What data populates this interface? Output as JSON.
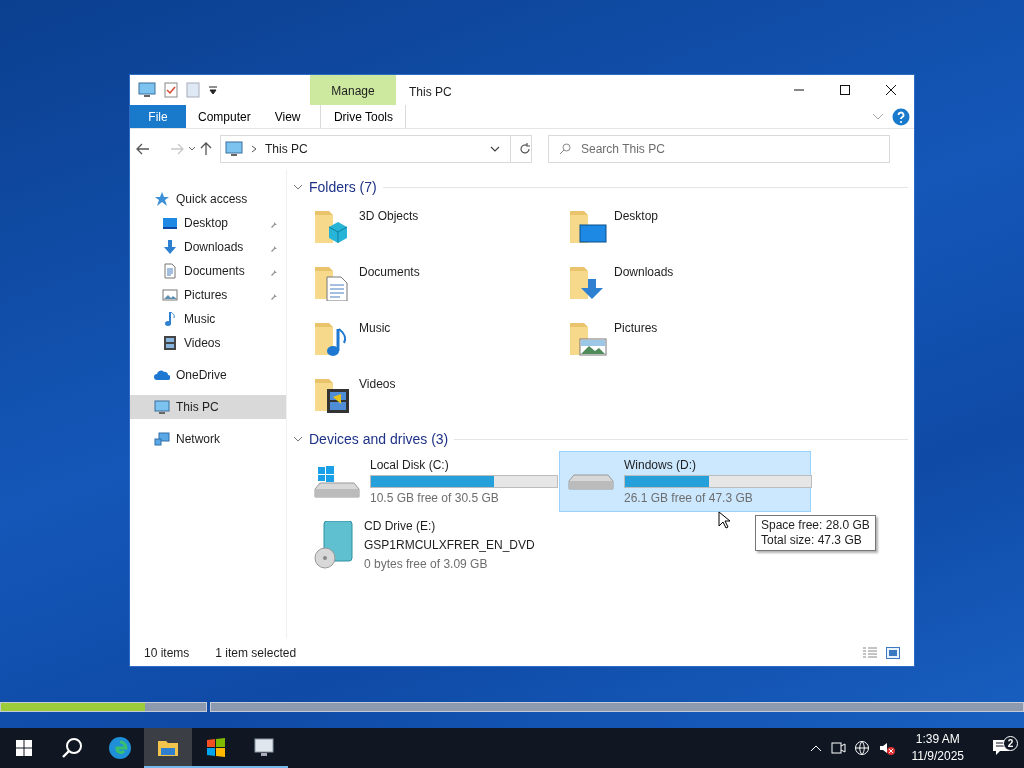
{
  "window": {
    "title": "This PC"
  },
  "ribbon": {
    "context_header": "Manage",
    "tabs": [
      {
        "label": "File",
        "kind": "file",
        "selected": false
      },
      {
        "label": "Computer",
        "kind": "tab",
        "selected": false
      },
      {
        "label": "View",
        "kind": "tab",
        "selected": false
      },
      {
        "label": "Drive Tools",
        "kind": "context",
        "selected": false
      }
    ]
  },
  "address_bar": {
    "path": "This PC"
  },
  "search": {
    "placeholder": "Search This PC"
  },
  "sidebar": {
    "items": [
      {
        "label": "Quick access",
        "kind": "star",
        "selected": false,
        "children": [
          {
            "label": "Desktop",
            "kind": "desktop",
            "pinned": true,
            "selected": false
          },
          {
            "label": "Downloads",
            "kind": "download",
            "pinned": true,
            "selected": false
          },
          {
            "label": "Documents",
            "kind": "document",
            "pinned": true,
            "selected": false
          },
          {
            "label": "Pictures",
            "kind": "picture",
            "pinned": true,
            "selected": false
          },
          {
            "label": "Music",
            "kind": "music",
            "pinned": false,
            "selected": false
          },
          {
            "label": "Videos",
            "kind": "video",
            "pinned": false,
            "selected": false
          }
        ]
      },
      {
        "label": "OneDrive",
        "kind": "cloud",
        "selected": false
      },
      {
        "label": "This PC",
        "kind": "pc",
        "selected": true
      },
      {
        "label": "Network",
        "kind": "network",
        "selected": false
      }
    ]
  },
  "folders": {
    "title": "Folders (7)",
    "expanded": true,
    "items": [
      {
        "name": "3D Objects",
        "kind": "cube"
      },
      {
        "name": "Desktop",
        "kind": "desktop"
      },
      {
        "name": "Documents",
        "kind": "document"
      },
      {
        "name": "Downloads",
        "kind": "download"
      },
      {
        "name": "Music",
        "kind": "music"
      },
      {
        "name": "Pictures",
        "kind": "picture"
      },
      {
        "name": "Videos",
        "kind": "video"
      }
    ]
  },
  "drives": {
    "title": "Devices and drives (3)",
    "expanded": true,
    "items": [
      {
        "name": "Local Disk (C:)",
        "kind": "system",
        "level": 0.66,
        "free": "10.5 GB free of 30.5 GB",
        "selected": false
      },
      {
        "name": "Windows (D:)",
        "kind": "disk",
        "level": 0.45,
        "free": "26.1 GB free of 47.3 GB",
        "selected": true
      },
      {
        "name": "CD Drive (E:)",
        "kind": "cd",
        "label": "GSP1RMCULXFRER_EN_DVD",
        "free": "0 bytes free of 3.09 GB",
        "selected": false
      }
    ]
  },
  "tooltip": {
    "lines": [
      "Space free: 28.0 GB",
      "Total size: 47.3 GB"
    ]
  },
  "status_bar": {
    "count": "10 items",
    "selection": "1 item selected"
  },
  "setup_progress": {
    "level": 0.7
  },
  "taskbar": {
    "apps": [
      {
        "kind": "edge",
        "active": false,
        "running": false
      },
      {
        "kind": "explorer",
        "active": true,
        "running": true
      },
      {
        "kind": "setup",
        "active": false,
        "running": true
      },
      {
        "kind": "monitor",
        "active": false,
        "running": true
      }
    ],
    "clock": {
      "time": "1:39 AM",
      "date": "11/9/2025"
    },
    "notifications": "2"
  }
}
